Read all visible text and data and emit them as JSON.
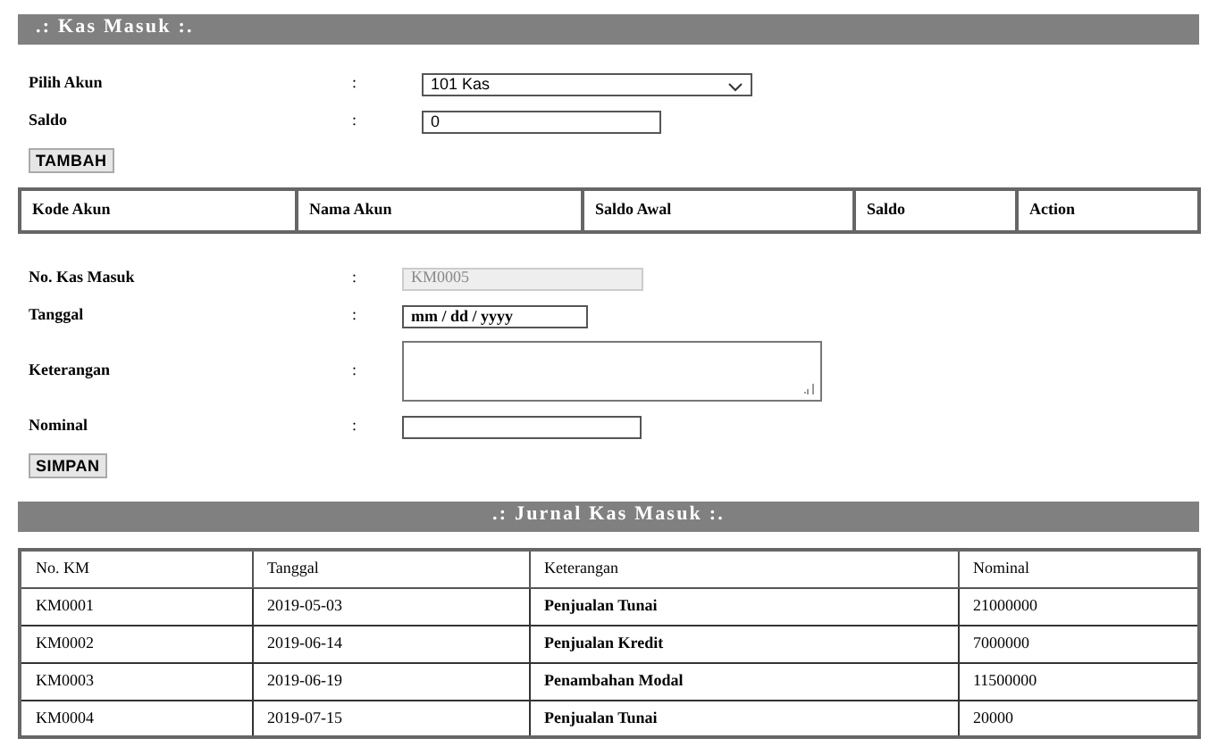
{
  "header": {
    "title": ".: Kas Masuk :."
  },
  "account_form": {
    "fields": [
      {
        "kind": "select",
        "label": "Pilih Akun",
        "separator": ":",
        "value": "101 Kas"
      },
      {
        "kind": "text",
        "label": "Saldo",
        "separator": ":",
        "value": "0"
      }
    ],
    "button": "TAMBAH"
  },
  "account_table": {
    "columns": [
      "Kode Akun",
      "Nama Akun",
      "Saldo Awal",
      "Saldo",
      "Action"
    ]
  },
  "entry_form": {
    "fields": [
      {
        "kind": "readonly",
        "label": "No. Kas Masuk",
        "separator": ":",
        "value": "KM0005",
        "disabled": true
      },
      {
        "kind": "date",
        "label": "Tanggal",
        "separator": ":",
        "placeholder": "mm / dd / yyyy"
      },
      {
        "kind": "textarea",
        "label": "Keterangan",
        "separator": ":"
      },
      {
        "kind": "text",
        "label": "Nominal",
        "separator": ":"
      }
    ],
    "button": "SIMPAN"
  },
  "journal": {
    "title": ".: Jurnal Kas Masuk :.",
    "columns": [
      "No. KM",
      "Tanggal",
      "Keterangan",
      "Nominal"
    ],
    "rows": [
      [
        "KM0001",
        "2019-05-03",
        "Penjualan Tunai",
        "21000000"
      ],
      [
        "KM0002",
        "2019-06-14",
        "Penjualan Kredit",
        "7000000"
      ],
      [
        "KM0003",
        "2019-06-19",
        "Penambahan Modal",
        "11500000"
      ],
      [
        "KM0004",
        "2019-07-15",
        "Penjualan Tunai",
        "20000"
      ]
    ]
  }
}
